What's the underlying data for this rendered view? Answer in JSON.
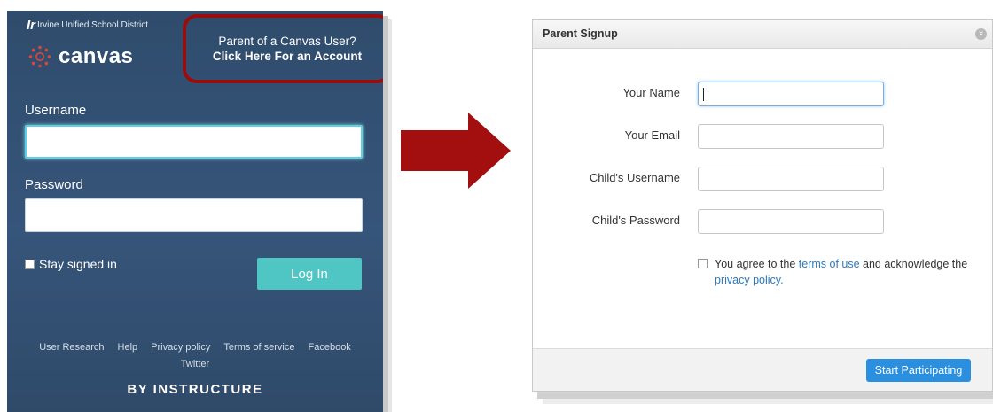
{
  "login": {
    "district_name": "Irvine Unified School District",
    "brand": "canvas",
    "parent_cta": {
      "line1": "Parent of a Canvas User?",
      "line2": "Click Here For an Account"
    },
    "username_label": "Username",
    "username_value": "",
    "password_label": "Password",
    "password_value": "",
    "stay_signed_in_label": "Stay signed in",
    "login_button": "Log In",
    "footer_links": [
      "User Research",
      "Help",
      "Privacy policy",
      "Terms of service",
      "Facebook"
    ],
    "twitter_link": "Twitter",
    "by_instructure": "BY INSTRUCTURE"
  },
  "dialog": {
    "title": "Parent Signup",
    "fields": [
      {
        "label": "Your Name",
        "value": ""
      },
      {
        "label": "Your Email",
        "value": ""
      },
      {
        "label": "Child's Username",
        "value": ""
      },
      {
        "label": "Child's Password",
        "value": ""
      }
    ],
    "agree": {
      "prefix": "You agree to the ",
      "terms_link": "terms of use",
      "middle": " and acknowledge the ",
      "privacy_link": "privacy policy",
      "suffix": "."
    },
    "submit_button": "Start Participating"
  },
  "colors": {
    "login_bg": "#34506f",
    "cta_border": "#9b0d0d",
    "login_button": "#4fc6c3",
    "arrow": "#a30f0f",
    "submit_button": "#2a8fde",
    "link": "#2d78b8"
  }
}
